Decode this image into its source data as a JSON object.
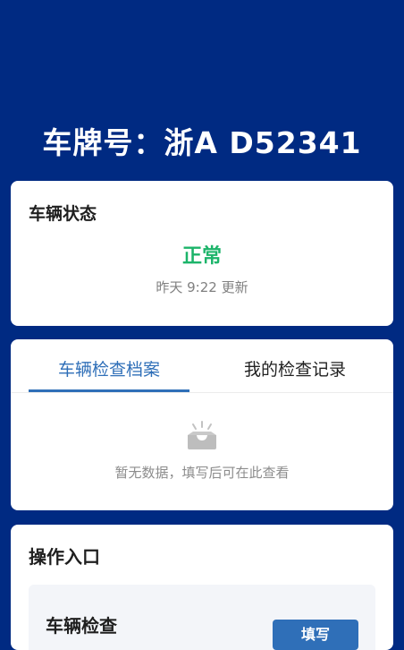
{
  "header": {
    "plate_title": "车牌号：浙A D52341"
  },
  "status_card": {
    "heading": "车辆状态",
    "status": "正常",
    "updated": "昨天 9:22 更新"
  },
  "tabs_card": {
    "tabs": [
      {
        "label": "车辆检查档案",
        "active": true
      },
      {
        "label": "我的检查记录",
        "active": false
      }
    ],
    "empty_icon": "empty-inbox-icon",
    "empty_text": "暂无数据，填写后可在此查看"
  },
  "operations_card": {
    "heading": "操作入口",
    "items": [
      {
        "title": "车辆检查",
        "button_label": "填写"
      }
    ]
  },
  "colors": {
    "background": "#002a82",
    "accent": "#2f6fb8",
    "status_ok": "#1cb46a"
  }
}
